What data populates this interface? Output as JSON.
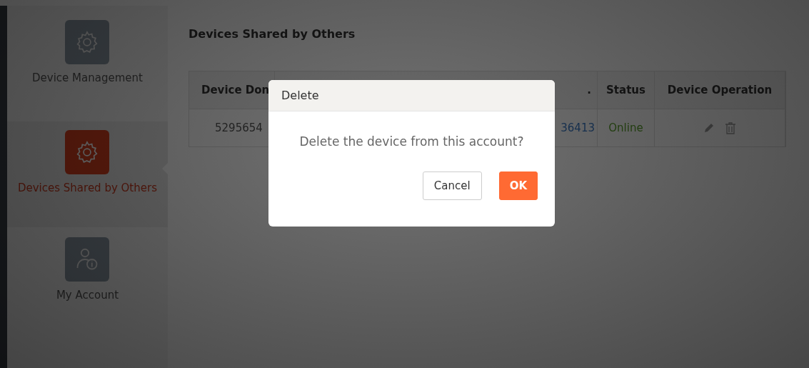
{
  "sidebar": {
    "items": [
      {
        "label": "Device Management",
        "kind": "gear",
        "selected": false
      },
      {
        "label": "Devices Shared by Others",
        "kind": "gear",
        "selected": true
      },
      {
        "label": "My Account",
        "kind": "account",
        "selected": false
      }
    ]
  },
  "page_title": "Devices Shared by Others",
  "table": {
    "columns": [
      "Device Don",
      ".",
      "Status",
      "Device Operation"
    ],
    "rows": [
      {
        "cells": [
          "5295654",
          "36413",
          "Online"
        ]
      }
    ]
  },
  "dialog": {
    "title": "Delete",
    "message": "Delete the device from this account?",
    "buttons": [
      {
        "label": "Cancel",
        "kind": "secondary"
      },
      {
        "label": "OK",
        "kind": "primary"
      }
    ]
  }
}
